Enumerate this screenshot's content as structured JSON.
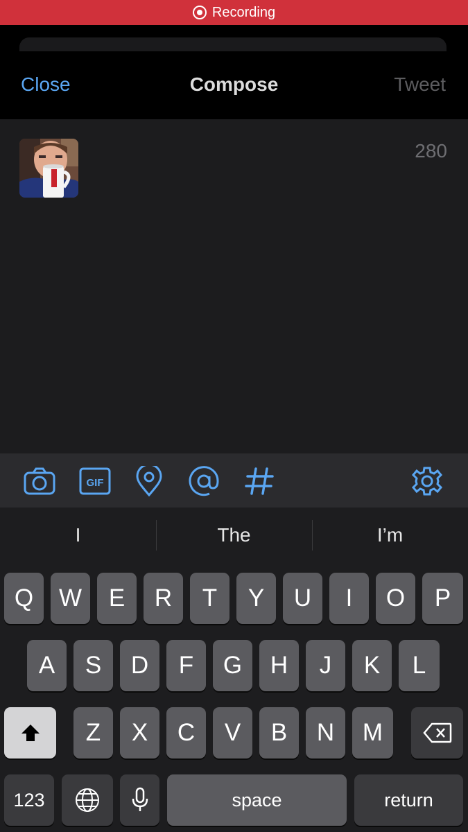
{
  "status_bar": {
    "recording_label": "Recording"
  },
  "nav": {
    "close_label": "Close",
    "title": "Compose",
    "tweet_label": "Tweet"
  },
  "compose": {
    "char_counter": "280"
  },
  "toolbar": {
    "icons": [
      "camera-icon",
      "gif-icon",
      "location-pin-icon",
      "mention-icon",
      "hashtag-icon",
      "gear-icon"
    ],
    "gif_text": "GIF",
    "accent_color": "#5aa6f2"
  },
  "keyboard": {
    "suggestions": [
      "I",
      "The",
      "I’m"
    ],
    "row1": [
      "Q",
      "W",
      "E",
      "R",
      "T",
      "Y",
      "U",
      "I",
      "O",
      "P"
    ],
    "row2": [
      "A",
      "S",
      "D",
      "F",
      "G",
      "H",
      "J",
      "K",
      "L"
    ],
    "row3": [
      "Z",
      "X",
      "C",
      "V",
      "B",
      "N",
      "M"
    ],
    "numbers_label": "123",
    "space_label": "space",
    "return_label": "return"
  }
}
